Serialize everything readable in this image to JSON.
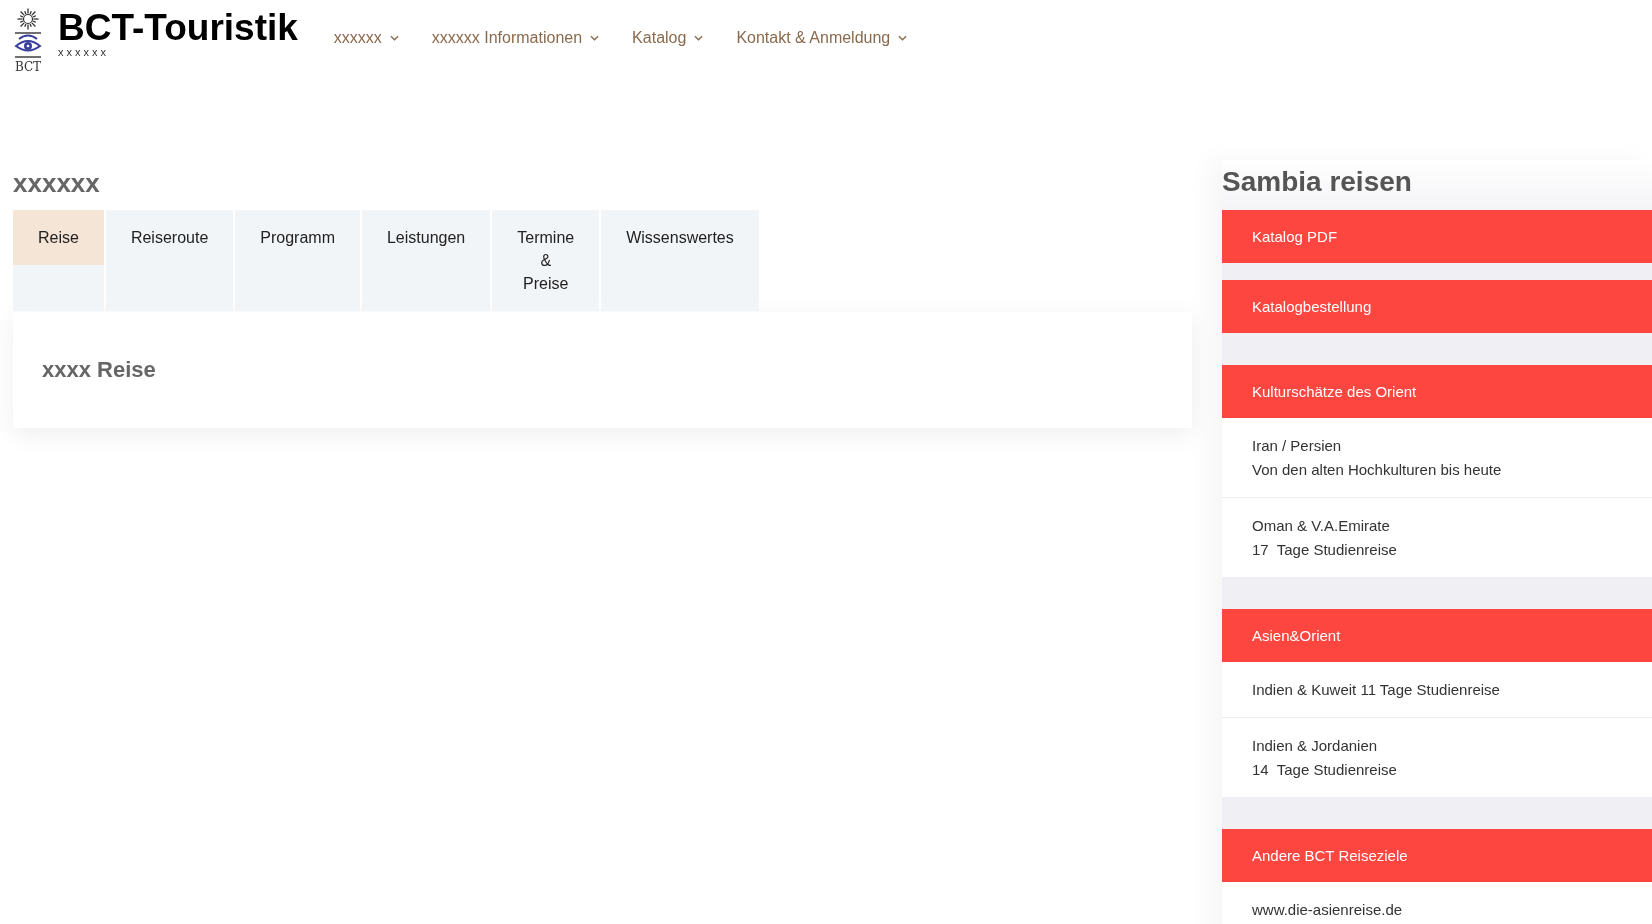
{
  "header": {
    "logo_caption": "BCT",
    "site_title": "BCT-Touristik",
    "tagline": "xxxxxx",
    "nav": [
      {
        "label": "xxxxxx",
        "dropdown": true
      },
      {
        "label": "xxxxxx Informationen",
        "dropdown": true
      },
      {
        "label": "Katalog",
        "dropdown": true
      },
      {
        "label": "Kontakt & Anmeldung",
        "dropdown": true
      }
    ]
  },
  "main": {
    "heading": "xxxxxx",
    "tabs": [
      {
        "label": "Reise",
        "selected": true
      },
      {
        "label": "Reiseroute",
        "selected": false
      },
      {
        "label": "Programm",
        "selected": false
      },
      {
        "label": "Leistungen",
        "selected": false
      },
      {
        "label": "Termine & Preise",
        "selected": false
      },
      {
        "label": "Wissenswertes",
        "selected": false
      }
    ],
    "panel": {
      "heading": "xxxx Reise"
    }
  },
  "sidebar": {
    "title": "Sambia reisen",
    "widgets": [
      {
        "kind": "buttons",
        "buttons": [
          "Katalog PDF",
          "Katalogbestellung"
        ]
      },
      {
        "kind": "list",
        "header": "Kulturschätze des Orient",
        "items": [
          "Iran / Persien\nVon den alten Hochkulturen bis heute",
          "Oman & V.A.Emirate\n17  Tage Studienreise"
        ]
      },
      {
        "kind": "list",
        "header": "Asien&Orient",
        "items": [
          "Indien & Kuweit 11 Tage Studienreise",
          "Indien & Jordanien\n14  Tage Studienreise"
        ]
      },
      {
        "kind": "list",
        "header": "Andere BCT Reiseziele",
        "items": [
          "www.die-asienreise.de"
        ]
      }
    ]
  }
}
